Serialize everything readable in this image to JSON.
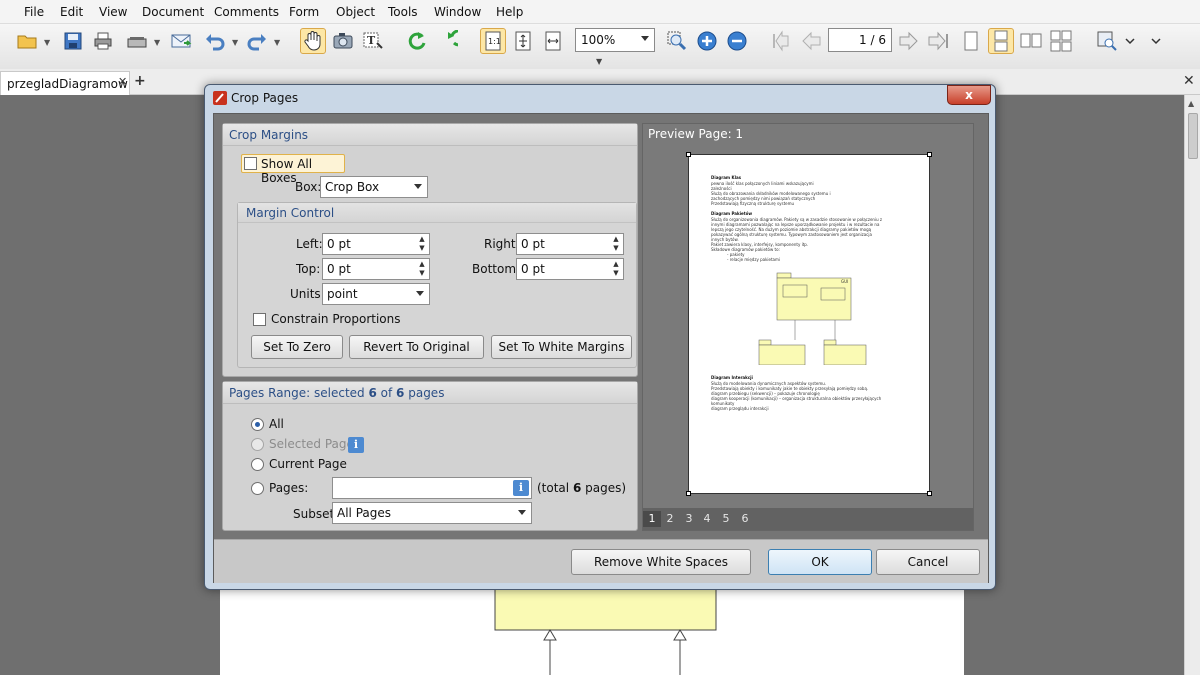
{
  "menubar": {
    "items": [
      "File",
      "Edit",
      "View",
      "Document",
      "Comments",
      "Form",
      "Object",
      "Tools",
      "Window",
      "Help"
    ]
  },
  "toolbar": {
    "zoom_value": "100%",
    "page_indicator": "1 / 6",
    "icons": [
      "open-folder-icon",
      "save-icon",
      "print-icon",
      "scanner-icon",
      "email-icon",
      "undo-icon",
      "redo-icon",
      "hand-tool-icon",
      "snapshot-icon",
      "text-select-icon",
      "rotate-ccw-icon",
      "rotate-cw-icon",
      "actual-size-icon",
      "fit-page-icon",
      "fit-width-icon",
      "zoom-select-icon",
      "zoom-in-icon",
      "zoom-out-icon",
      "first-page-icon",
      "prev-page-icon",
      "next-page-icon",
      "last-page-icon",
      "single-page-icon",
      "continuous-icon",
      "facing-icon",
      "facing-continuous-icon",
      "find-icon"
    ]
  },
  "tabs": {
    "document": "przegladDiagramow"
  },
  "dialog": {
    "title": "Crop Pages",
    "close_label": "x",
    "crop_margins": {
      "heading": "Crop Margins",
      "show_all_boxes": "Show All Boxes",
      "box_label": "Box:",
      "box_value": "Crop Box",
      "margin_control": "Margin Control",
      "left_label": "Left:",
      "left_value": "0 pt",
      "right_label": "Right:",
      "right_value": "0 pt",
      "top_label": "Top:",
      "top_value": "0 pt",
      "bottom_label": "Bottom:",
      "bottom_value": "0 pt",
      "units_label": "Units:",
      "units_value": "point",
      "constrain": "Constrain Proportions",
      "set_zero": "Set To Zero",
      "revert": "Revert To Original",
      "white_margins": "Set To White Margins"
    },
    "pages_range": {
      "heading_prefix": "Pages Range: selected ",
      "heading_selected": "6",
      "heading_mid": " of ",
      "heading_total": "6",
      "heading_suffix": " pages",
      "all": "All",
      "selected_pages": "Selected Pages",
      "current_page": "Current Page",
      "pages_label": "Pages:",
      "pages_value": "",
      "total_prefix": "(total ",
      "total_count": "6",
      "total_suffix": " pages)",
      "subset_label": "Subset:",
      "subset_value": "All Pages"
    },
    "preview": {
      "title": "Preview Page: 1",
      "page_numbers": [
        "1",
        "2",
        "3",
        "4",
        "5",
        "6"
      ],
      "content": {
        "h1": "Diagram Klas",
        "p1": [
          "pewna ilość klas połączonych liniami wskazującymi",
          "zależności",
          "Służą do obrazowania składników modelowanego systemu i",
          "zachodzących pomiędzy nimi powiązań statycznych",
          "Przedstawiają fizyczną strukturę systemu"
        ],
        "h2": "Diagram Pakietów",
        "p2": [
          "Służą do organizowania diagramów. Pakiety są w zasadzie stosowanie w połączeniu z",
          "innymi diagramami pozwalając na lepsze uporządkowanie projektu i w rezultacie na",
          "lepszą jego czytelność. Na dużym poziomie abstrakcji diagramy pakietów mogą",
          "pokazywać ogólną strukturę systemu. Typowym zastosowaniem jest organizacja",
          "innych bytów.",
          "Pakiet zawiera klasy, interfejsy, komponenty itp.",
          "Składowe diagramów pakietów to:",
          "- pakiety",
          "- relacje między pakietami"
        ],
        "pkg_label": "GUI",
        "h3": "Diagram Interakcji",
        "p3": [
          "Służą do modelowania dynamicznych aspektów systemu.",
          "Przedstawiają obiekty i komunikaty jakie te obiekty przesyłają pomiędzy sobą.",
          "diagram przebiegu (sekwencji) – pokazuje chronologię",
          "diagram kooperacji (komunikacji) – organizacja strukturalna obiektów przesyłających",
          "komunikaty",
          "diagram przeglądu interakcji"
        ]
      }
    },
    "buttons": {
      "remove_white": "Remove White Spaces",
      "ok": "OK",
      "cancel": "Cancel"
    }
  },
  "colors": {
    "accent": "#2c4f86",
    "ok_border": "#3c7fb1",
    "dialog_frame": "#c9d7e6",
    "diagram_fill": "#fafab4",
    "toggle_active": "#fde7a6"
  }
}
